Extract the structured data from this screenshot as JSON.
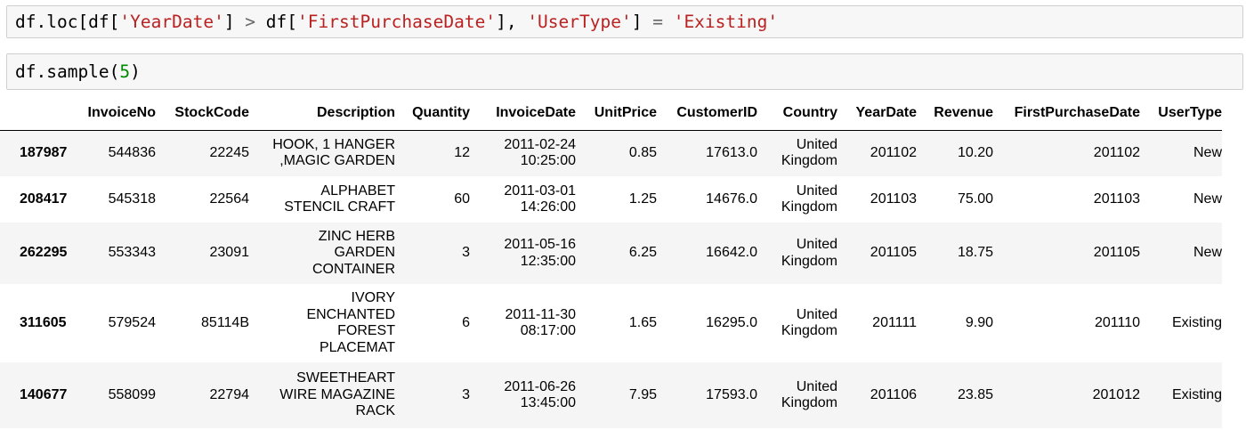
{
  "cells": [
    {
      "tokens": [
        {
          "t": "df.loc[df[",
          "k": "plain"
        },
        {
          "t": "'YearDate'",
          "k": "str"
        },
        {
          "t": "] ",
          "k": "plain"
        },
        {
          "t": ">",
          "k": "op"
        },
        {
          "t": " df[",
          "k": "plain"
        },
        {
          "t": "'FirstPurchaseDate'",
          "k": "str"
        },
        {
          "t": "], ",
          "k": "plain"
        },
        {
          "t": "'UserType'",
          "k": "str"
        },
        {
          "t": "] ",
          "k": "plain"
        },
        {
          "t": "=",
          "k": "op"
        },
        {
          "t": " ",
          "k": "plain"
        },
        {
          "t": "'Existing'",
          "k": "str"
        }
      ]
    },
    {
      "tokens": [
        {
          "t": "df.sample(",
          "k": "plain"
        },
        {
          "t": "5",
          "k": "num"
        },
        {
          "t": ")",
          "k": "plain"
        }
      ]
    }
  ],
  "table": {
    "columns": [
      "",
      "InvoiceNo",
      "StockCode",
      "Description",
      "Quantity",
      "InvoiceDate",
      "UnitPrice",
      "CustomerID",
      "Country",
      "YearDate",
      "Revenue",
      "FirstPurchaseDate",
      "UserType"
    ],
    "rows": [
      {
        "index": "187987",
        "cells": [
          "544836",
          "22245",
          [
            "HOOK, 1 HANGER",
            ",MAGIC GARDEN"
          ],
          "12",
          [
            "2011-02-24",
            "10:25:00"
          ],
          "0.85",
          "17613.0",
          [
            "United",
            "Kingdom"
          ],
          "201102",
          "10.20",
          "201102",
          "New"
        ]
      },
      {
        "index": "208417",
        "cells": [
          "545318",
          "22564",
          [
            "ALPHABET",
            "STENCIL CRAFT"
          ],
          "60",
          [
            "2011-03-01",
            "14:26:00"
          ],
          "1.25",
          "14676.0",
          [
            "United",
            "Kingdom"
          ],
          "201103",
          "75.00",
          "201103",
          "New"
        ]
      },
      {
        "index": "262295",
        "cells": [
          "553343",
          "23091",
          [
            "ZINC HERB",
            "GARDEN",
            "CONTAINER"
          ],
          "3",
          [
            "2011-05-16",
            "12:35:00"
          ],
          "6.25",
          "16642.0",
          [
            "United",
            "Kingdom"
          ],
          "201105",
          "18.75",
          "201105",
          "New"
        ]
      },
      {
        "index": "311605",
        "cells": [
          "579524",
          "85114B",
          [
            "IVORY",
            "ENCHANTED",
            "FOREST",
            "PLACEMAT"
          ],
          "6",
          [
            "2011-11-30",
            "08:17:00"
          ],
          "1.65",
          "16295.0",
          [
            "United",
            "Kingdom"
          ],
          "201111",
          "9.90",
          "201110",
          "Existing"
        ]
      },
      {
        "index": "140677",
        "cells": [
          "558099",
          "22794",
          [
            "SWEETHEART",
            "WIRE MAGAZINE",
            "RACK"
          ],
          "3",
          [
            "2011-06-26",
            "13:45:00"
          ],
          "7.95",
          "17593.0",
          [
            "United",
            "Kingdom"
          ],
          "201106",
          "23.85",
          "201012",
          "Existing"
        ]
      }
    ]
  }
}
